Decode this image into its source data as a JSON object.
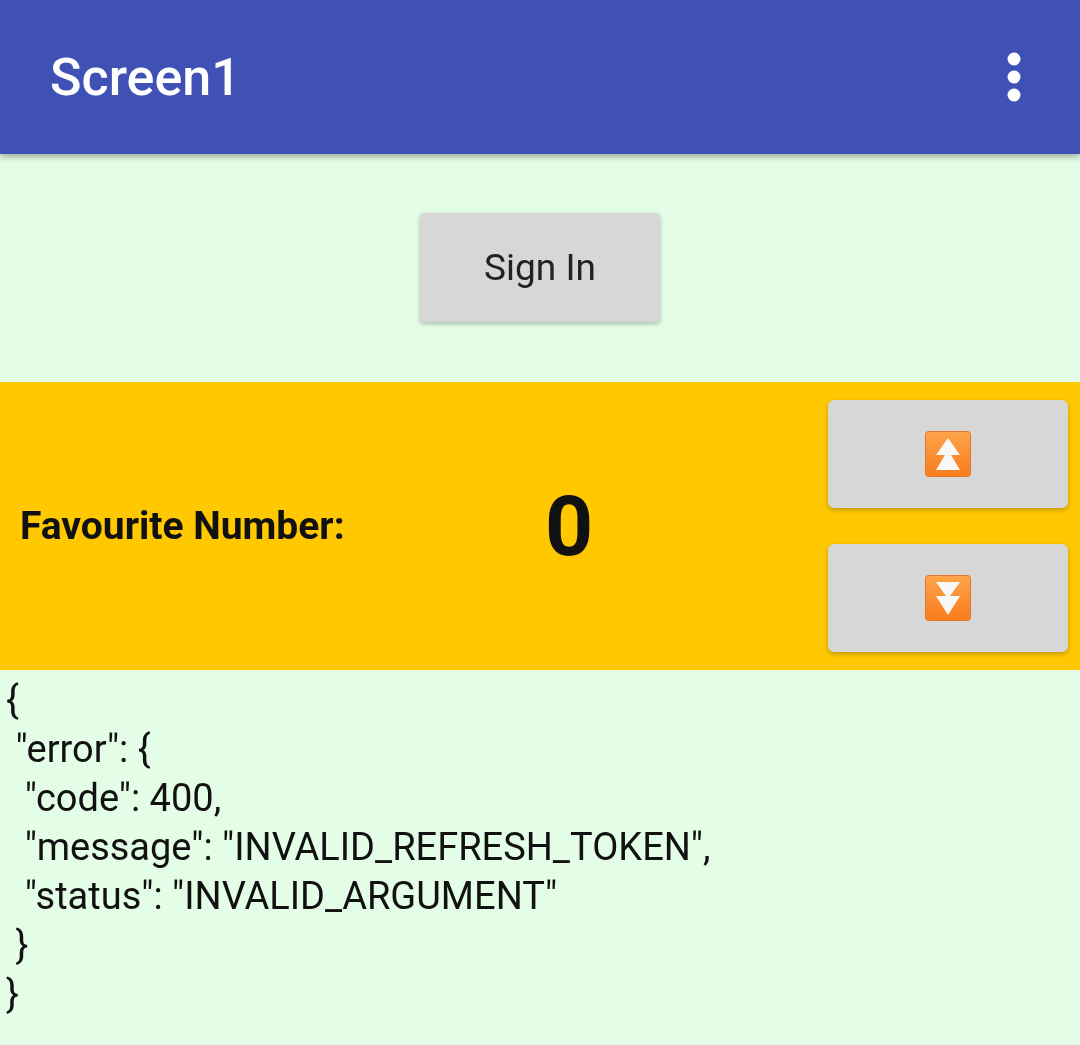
{
  "app_bar": {
    "title": "Screen1"
  },
  "sign_in_button": {
    "label": "Sign In"
  },
  "favourite_panel": {
    "label": "Favourite Number:",
    "value": "0",
    "buttons": [
      {
        "kind": "up"
      },
      {
        "kind": "down"
      }
    ]
  },
  "response_text": "{\n \"error\": {\n  \"code\": 400,\n  \"message\": \"INVALID_REFRESH_TOKEN\",\n  \"status\": \"INVALID_ARGUMENT\"\n }\n}"
}
